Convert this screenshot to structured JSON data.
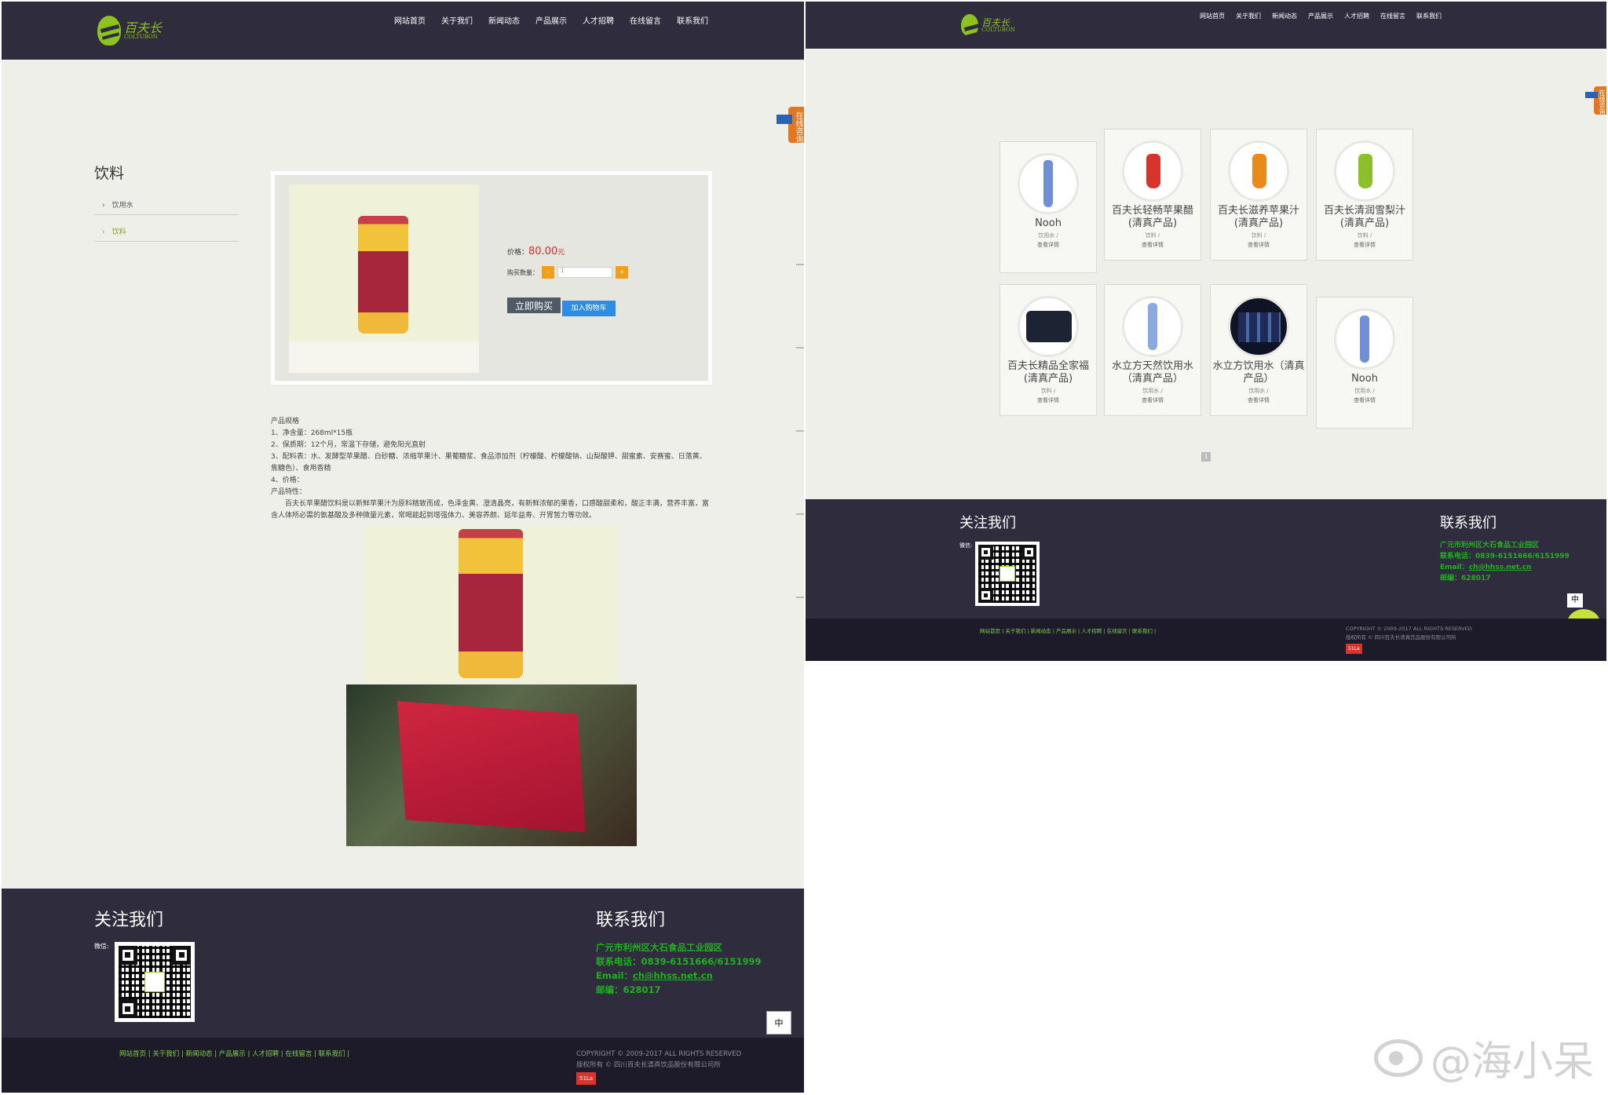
{
  "nav": [
    "网站首页",
    "关于我们",
    "新闻动态",
    "产品展示",
    "人才招聘",
    "在线留言",
    "联系我们"
  ],
  "logo": {
    "cn": "百夫长",
    "en": "COLTUBON"
  },
  "side_tab": "在线咨询",
  "left": {
    "category_title": "饮料",
    "sub_items": [
      "饮用水",
      "饮料"
    ],
    "price_label": "价格：",
    "price": "80.00",
    "price_unit": "元",
    "qty_label": "购买数量：",
    "qty_minus": "-",
    "qty_value": "1",
    "qty_plus": "+",
    "buy_now": "立即购买",
    "add_cart": "加入购物车",
    "spec_lines": [
      "产品规格",
      "1、净含量：268ml*15瓶",
      "2、保质期：12个月，常温下存储，避免阳光直射",
      "3、配料表：水、发酵型苹果醋、白砂糖、浓缩苹果汁、果葡糖浆、食品添加剂（柠檬酸、柠檬酸钠、山梨酸钾、甜蜜素、安赛蜜、日落黄、焦糖色）、食用香精",
      "4、价格：",
      "产品特性：",
      "　　百夫长苹果醋饮料是以新鲜苹果汁为原料精致而成，色泽金黄、澄清晶亮，有新鲜浓郁的果香，口感酸甜柔和，酸正丰满，营养丰富，富含人体所必需的氨基酸及多种微量元素，常喝能起到增强体力、美容养颜、延年益寿、开胃暂力等功效。"
    ]
  },
  "right": {
    "products": [
      {
        "name": "Nooh",
        "cat": "饮用水 /",
        "more": "查看详情",
        "color": "#6f8fd8"
      },
      {
        "name": "百夫长轻畅苹果醋(清真产品)",
        "cat": "饮料 /",
        "more": "查看详情",
        "color": "#d9342a"
      },
      {
        "name": "百夫长滋养苹果汁(清真产品)",
        "cat": "饮料 /",
        "more": "查看详情",
        "color": "#e98a1a"
      },
      {
        "name": "百夫长清润雪梨汁(清真产品)",
        "cat": "饮料 /",
        "more": "查看详情",
        "color": "#8cbf2c"
      },
      {
        "name": "百夫长精品全家福(清真产品)",
        "cat": "饮料 /",
        "more": "查看详情",
        "color": "#1c2433"
      },
      {
        "name": "水立方天然饮用水（清真产品）",
        "cat": "饮用水 /",
        "more": "查看详情",
        "color": "#8aa9e3"
      },
      {
        "name": "水立方饮用水（清真产品）",
        "cat": "饮用水 /",
        "more": "查看详情",
        "color": "#1e2c55"
      },
      {
        "name": "Nooh",
        "cat": "饮用水 /",
        "more": "查看详情",
        "color": "#6f8fd8"
      }
    ],
    "page": "1"
  },
  "footer": {
    "follow_title": "关注我们",
    "wechat_label": "微信:",
    "contact_title": "联系我们",
    "address": "广元市利州区大石食品工业园区",
    "phone": "联系电话：0839-6151666/6151999",
    "email_label": "Email：",
    "email": "ch@hhss.net.cn",
    "zip": "邮编：628017",
    "links": "网站首页 | 关于我们 | 新闻动态 | 产品展示 | 人才招聘 | 在线留言 | 联系我们 |",
    "copyright": "COPYRIGHT © 2009-2017 ALL RIGHTS RESERVED",
    "owner": "版权所有 © 四川百夫长清真饮品股份有限公司所",
    "badge": "51La",
    "im_char": "中"
  },
  "watermark": "@海小呆"
}
